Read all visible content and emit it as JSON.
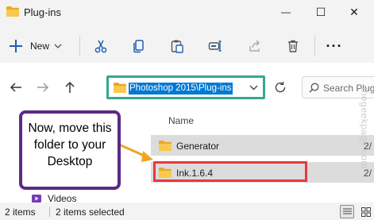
{
  "window": {
    "title": "Plug-ins",
    "minimize_glyph": "—",
    "maximize_glyph": "☐",
    "close_glyph": "✕"
  },
  "toolbar": {
    "new_label": "New",
    "more_glyph": "···"
  },
  "address": {
    "path": "Photoshop 2015\\Plug-ins",
    "search_placeholder": "Search Plug"
  },
  "columns": {
    "name": "Name"
  },
  "files": [
    {
      "name": "Generator",
      "date": "2/"
    },
    {
      "name": "Ink.1.6.4",
      "date": "2/"
    }
  ],
  "sidebar": {
    "visible_item": "Videos"
  },
  "status": {
    "items_count": "2 items",
    "selected": "2 items selected"
  },
  "annotation": {
    "text": "Now, move this folder to your Desktop"
  },
  "watermark": "thegeekpage.com",
  "colors": {
    "address_highlight": "#35a88f",
    "selection_outline": "#e8393c",
    "callout_border": "#5b2a86",
    "arrow": "#f2a51f",
    "folder": "#f4c14a"
  }
}
